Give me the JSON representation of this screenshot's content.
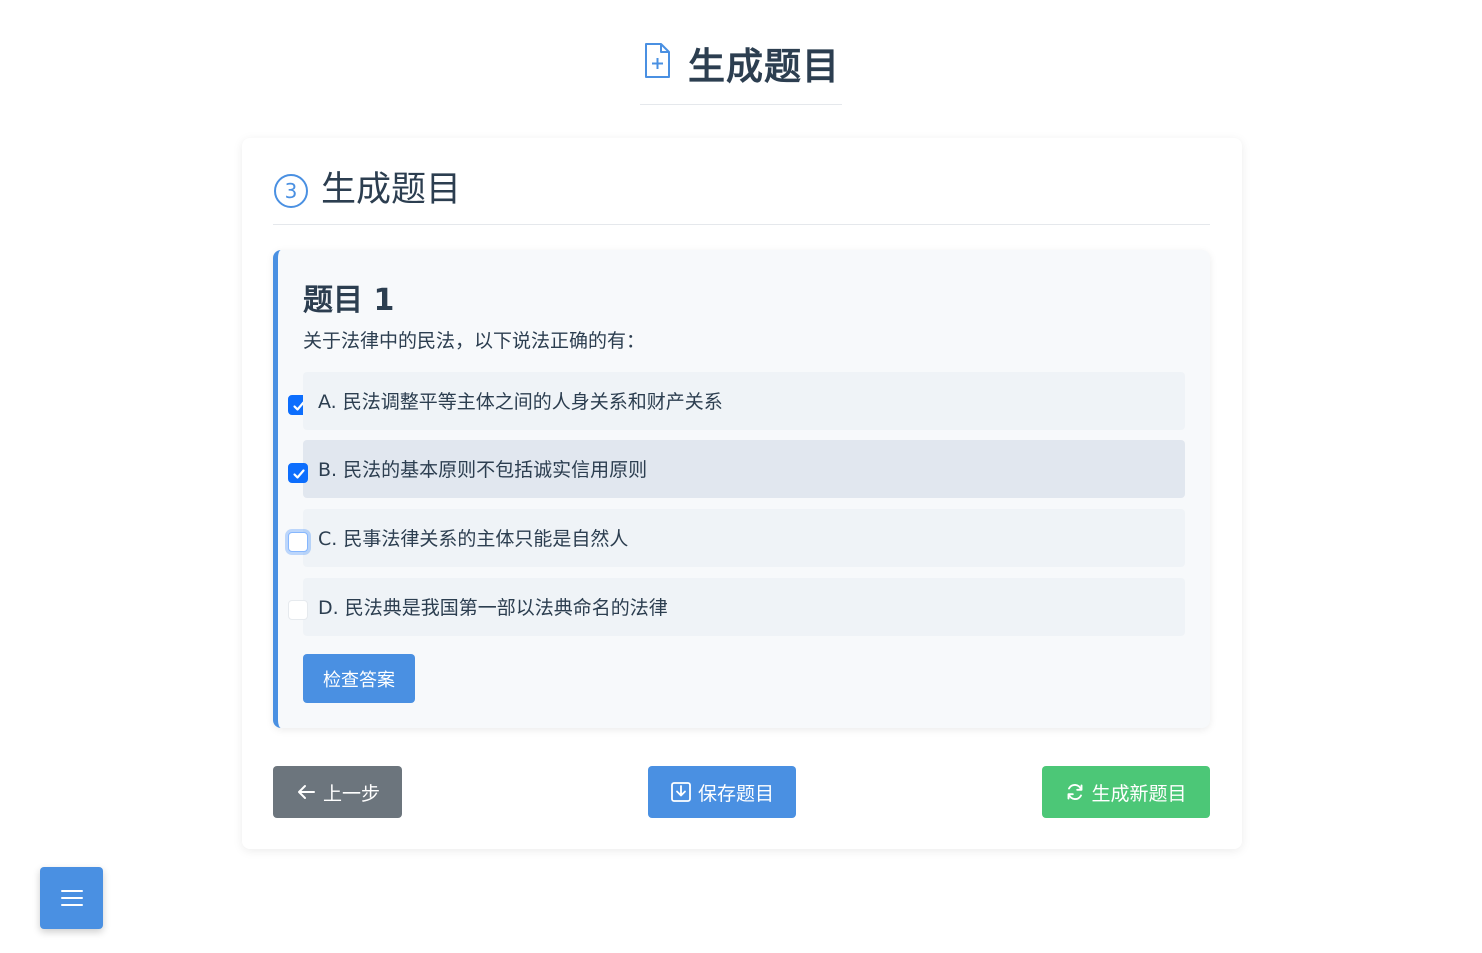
{
  "header": {
    "title": "生成题目",
    "icon": "file-plus-icon"
  },
  "step": {
    "number": "3",
    "title": "生成题目"
  },
  "question": {
    "title": "题目 1",
    "text": "关于法律中的民法，以下说法正确的有：",
    "options": [
      {
        "label": "A. 民法调整平等主体之间的人身关系和财产关系",
        "checked": true
      },
      {
        "label": "B. 民法的基本原则不包括诚实信用原则",
        "checked": true
      },
      {
        "label": "C. 民事法律关系的主体只能是自然人",
        "checked": false
      },
      {
        "label": "D. 民法典是我国第一部以法典命名的法律",
        "checked": false
      }
    ],
    "check_button": "检查答案"
  },
  "nav": {
    "prev_label": "上一步",
    "save_label": "保存题目",
    "new_label": "生成新题目"
  },
  "colors": {
    "primary": "#4a90e2",
    "success": "#4cc777",
    "secondary": "#6c757d",
    "checkbox": "#0d6efd"
  }
}
